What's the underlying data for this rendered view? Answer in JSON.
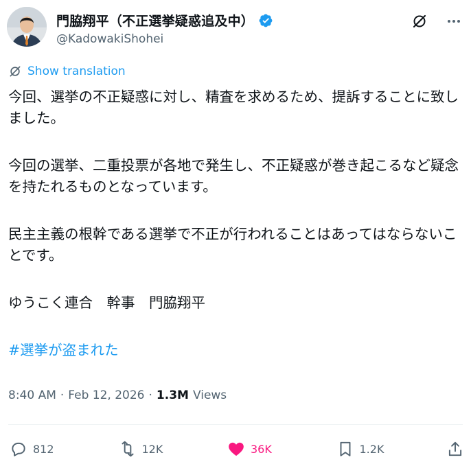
{
  "author": {
    "display_name": "門脇翔平（不正選挙疑惑追及中）",
    "handle": "@KadowakiShohei",
    "verified": true
  },
  "icons": {
    "avatar": "profile-photo",
    "verified": "verified-badge-icon",
    "grok": "grok-icon",
    "more": "more-icon",
    "translate": "translate-icon",
    "reply": "reply-icon",
    "retweet": "retweet-icon",
    "like": "heart-icon",
    "bookmark": "bookmark-icon",
    "share": "share-icon"
  },
  "translate_label": "Show translation",
  "tweet": {
    "paragraphs": [
      "今回、選挙の不正疑惑に対し、精査を求めるため、提訴することに致しました。",
      "今回の選挙、二重投票が各地で発生し、不正疑惑が巻き起こるなど疑念を持たれるものとなっています。",
      "民主主義の根幹である選挙で不正が行われることはあってはならないことです。",
      "ゆうこく連合　幹事　門脇翔平"
    ],
    "hashtag": "#選挙が盗まれた"
  },
  "meta": {
    "time": "8:40 AM",
    "sep1": "·",
    "date": "Feb 12, 2026",
    "sep2": "·",
    "views_count": "1.3M",
    "views_label": "Views"
  },
  "actions": {
    "reply_count": "812",
    "retweet_count": "12K",
    "like_count": "36K",
    "bookmark_count": "1.2K"
  },
  "colors": {
    "accent": "#1d9bf0",
    "like": "#f91880",
    "secondary_text": "#536471",
    "text": "#0f1419"
  }
}
